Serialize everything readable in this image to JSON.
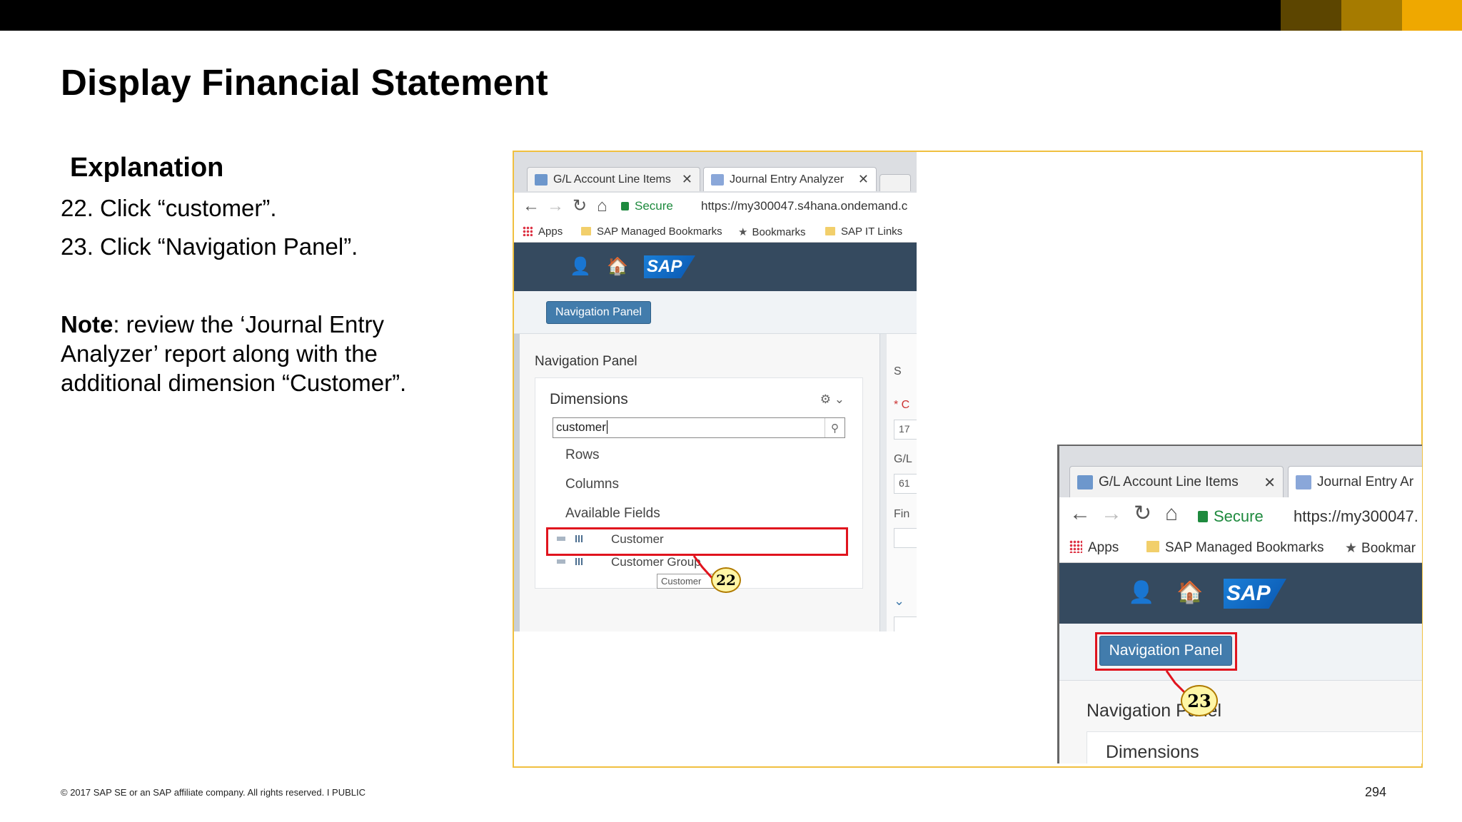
{
  "slide": {
    "title": "Display Financial Statement",
    "explanation_heading": "Explanation",
    "steps": [
      "22. Click “customer”.",
      "23. Click “Navigation Panel”."
    ],
    "note_label": "Note",
    "note_text": ": review the ‘Journal Entry Analyzer’ report along with the additional dimension “Customer”.",
    "footer": "© 2017 SAP SE or an SAP affiliate company. All rights reserved.   I   PUBLIC",
    "page_number": "294"
  },
  "colors": {
    "accent_dark": "#5c4500",
    "accent_mid": "#a67b00",
    "accent_light": "#efa800",
    "highlight_red": "#e0141e",
    "shell_bar": "#354a5f",
    "nav_button": "#427cac"
  },
  "screenshot_a": {
    "tabs": [
      {
        "label": "G/L Account Line Items",
        "close": "✕"
      },
      {
        "label": "Journal Entry Analyzer",
        "close": "✕"
      }
    ],
    "secure_label": "Secure",
    "url": "https://my300047.s4hana.ondemand.c",
    "bookmarks": [
      "Apps",
      "SAP Managed Bookmarks",
      "Bookmarks",
      "SAP IT Links"
    ],
    "shell_logo": "SAP",
    "navigation_panel_button": "Navigation Panel",
    "panel_label": "Navigation Panel",
    "dimensions_title": "Dimensions",
    "search_value": "customer",
    "groups": [
      "Rows",
      "Columns",
      "Available Fields"
    ],
    "fields": [
      "Customer",
      "Customer Group"
    ],
    "tooltip": "Customer",
    "callout": "22",
    "right_pane": {
      "item1": "S",
      "item2": "* C",
      "input1": "17",
      "item3": "G/L",
      "input2": "61",
      "item4": "Fin"
    }
  },
  "screenshot_b": {
    "tabs": [
      {
        "label": "G/L Account Line Items",
        "close": "✕"
      },
      {
        "label": "Journal Entry Ar"
      }
    ],
    "secure_label": "Secure",
    "url": "https://my300047.",
    "bookmarks": [
      "Apps",
      "SAP Managed Bookmarks",
      "Bookmar"
    ],
    "shell_logo": "SAP",
    "navigation_panel_button": "Navigation Panel",
    "panel_label": "Navigation Panel",
    "dimensions_title": "Dimensions",
    "callout": "23"
  }
}
